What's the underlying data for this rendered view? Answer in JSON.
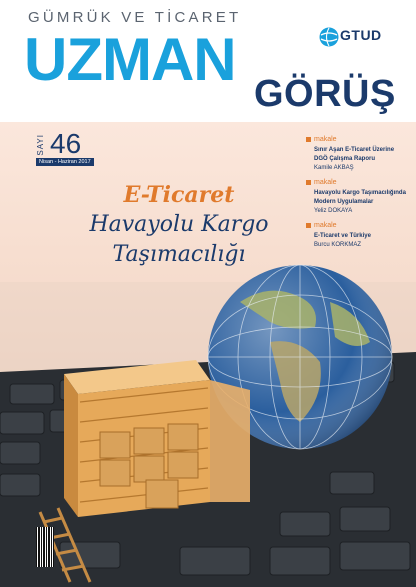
{
  "masthead": {
    "subtitle": "GÜMRÜK VE TİCARET",
    "title_main": "UZMAN",
    "title_second": "GÖRÜŞ",
    "publisher_logo": "GTUD"
  },
  "issue": {
    "label": "SAYI",
    "number": "46",
    "date": "Nisan - Haziran 2017"
  },
  "headline": {
    "line1": "E-Ticaret",
    "line2": "Havayolu Kargo",
    "line3": "Taşımacılığı"
  },
  "toc": [
    {
      "category": "makale",
      "title": "Sınır Aşan E-Ticaret Üzerine DGÖ Çalışma Raporu",
      "author": "Kamile AKBAŞ"
    },
    {
      "category": "makale",
      "title": "Havayolu Kargo Taşımacılığında Modern Uygulamalar",
      "author": "Yeliz DOKAYA"
    },
    {
      "category": "makale",
      "title": "E-Ticaret ve Türkiye",
      "author": "Burcu KORKMAZ"
    }
  ],
  "colors": {
    "accent_blue": "#1aa1dc",
    "navy": "#1b3a6b",
    "orange": "#e07a2c"
  },
  "illustration": {
    "icons": [
      "globe-icon",
      "shipping-container-icon",
      "keyboard-icon",
      "barcode-icon"
    ]
  }
}
